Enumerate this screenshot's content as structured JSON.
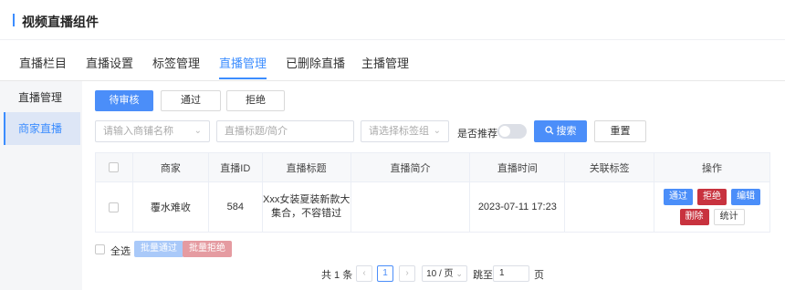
{
  "header": {
    "title": "视频直播组件"
  },
  "tabs": [
    {
      "label": "直播栏目"
    },
    {
      "label": "直播设置"
    },
    {
      "label": "标签管理"
    },
    {
      "label": "直播管理"
    },
    {
      "label": "已删除直播"
    },
    {
      "label": "主播管理"
    }
  ],
  "active_tab": "直播管理",
  "sidebar": {
    "items": [
      {
        "label": "直播管理"
      },
      {
        "label": "商家直播"
      }
    ],
    "active": "商家直播"
  },
  "status_filters": {
    "pending": "待审核",
    "approved": "通过",
    "rejected": "拒绝"
  },
  "filters": {
    "shop_placeholder": "请输入商铺名称",
    "title_placeholder": "直播标题/简介",
    "tag_placeholder": "请选择标签组",
    "recommend_label": "是否推荐",
    "search_label": "搜索",
    "reset_label": "重置"
  },
  "table": {
    "headers": {
      "merchant": "商家",
      "live_id": "直播ID",
      "live_title": "直播标题",
      "live_intro": "直播简介",
      "live_time": "直播时间",
      "tags": "关联标签",
      "actions": "操作"
    },
    "rows": [
      {
        "merchant": "覆水难收",
        "live_id": "584",
        "title_line1": "Xxx女装夏装新款大",
        "title_line2": "集合，不容错过",
        "intro": "",
        "time": "2023-07-11 17:23",
        "tags": "",
        "actions": {
          "approve": "通过",
          "reject": "拒绝",
          "edit": "编辑",
          "delete": "删除",
          "stats": "统计"
        }
      }
    ]
  },
  "batch": {
    "select_all": "全选",
    "batch_approve": "批量通过",
    "batch_reject": "批量拒绝"
  },
  "pagination": {
    "total": "共 1 条",
    "current_page": "1",
    "page_size": "10 / 页",
    "goto_label": "跳至",
    "goto_value": "1",
    "page_suffix": "页"
  },
  "colors": {
    "accent": "#4b8ef9",
    "danger": "#c8323e"
  }
}
